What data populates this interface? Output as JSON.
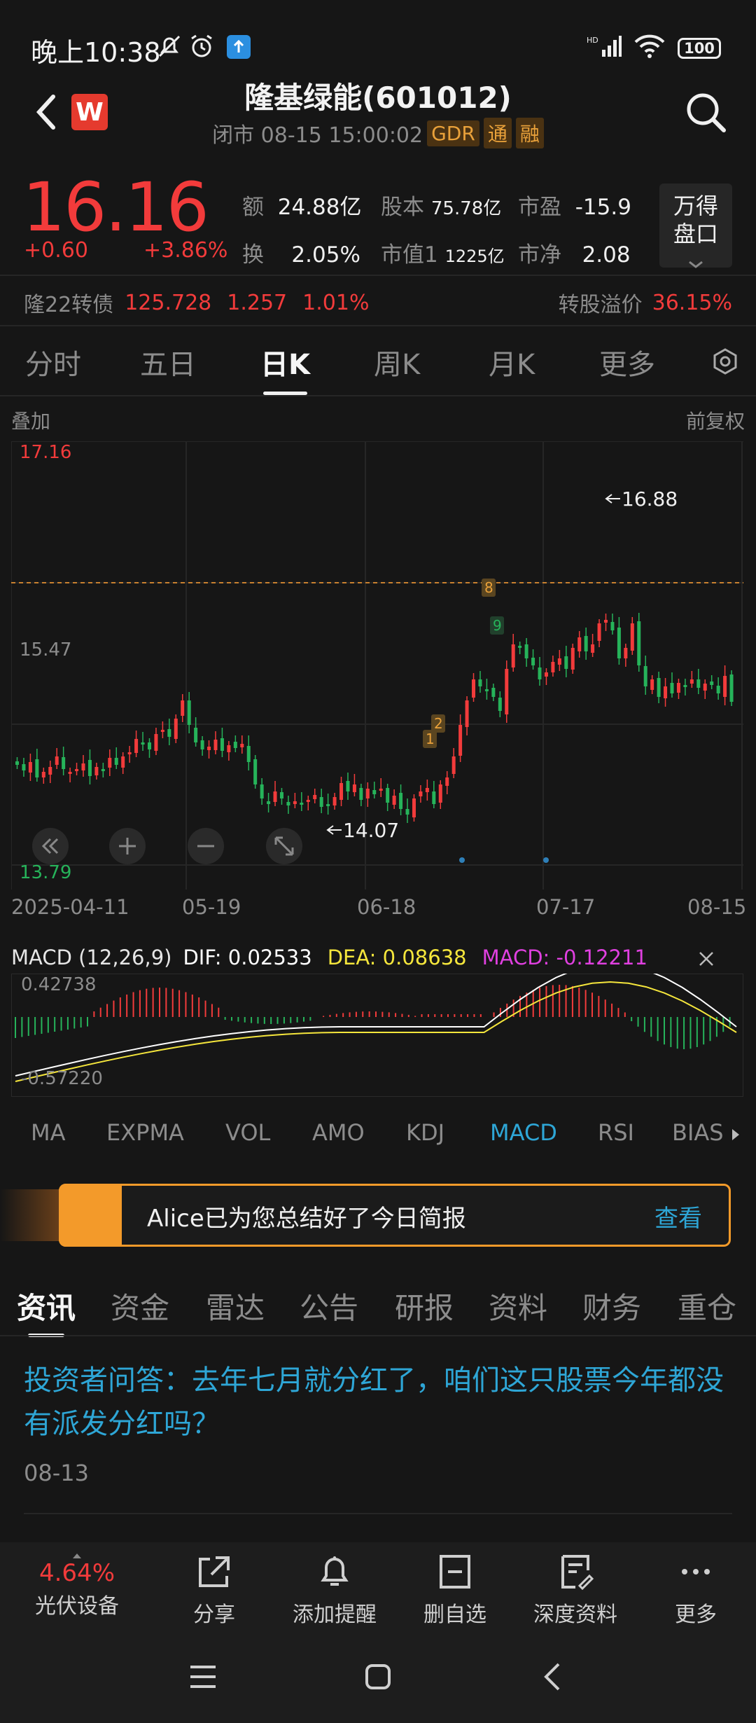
{
  "status": {
    "time": "晚上10:38",
    "battery": "100",
    "signal": "HD"
  },
  "header": {
    "title": "隆基绿能(601012)",
    "subtitle": "闭市 08-15 15:00:02",
    "tags": [
      "GDR",
      "通",
      "融"
    ],
    "logo": "W"
  },
  "quote": {
    "price": "16.16",
    "change": "+0.60",
    "change_pct": "+3.86%",
    "stats": [
      {
        "k": "额",
        "v": "24.88亿"
      },
      {
        "k": "股本",
        "v": "75.78亿"
      },
      {
        "k": "市盈",
        "v": "-15.9"
      },
      {
        "k": "换",
        "v": "2.05%"
      },
      {
        "k": "市值1",
        "v": "1225亿"
      },
      {
        "k": "市净",
        "v": "2.08"
      }
    ],
    "wande_line1": "万得",
    "wande_line2": "盘口"
  },
  "bond": {
    "name": "隆22转债",
    "price": "125.728",
    "change": "1.257",
    "pct": "1.01%",
    "premium_label": "转股溢价",
    "premium": "36.15%"
  },
  "chart_tabs": [
    "分时",
    "五日",
    "日K",
    "周K",
    "月K",
    "更多"
  ],
  "overlay_label": "叠加",
  "fq_label": "前复权",
  "kline": {
    "price_top": "17.16",
    "price_mid": "15.47",
    "price_bottom": "13.79",
    "high_label": "16.88",
    "low_label": "14.07",
    "markers": [
      "1",
      "2",
      "8",
      "9"
    ],
    "dates": [
      "2025-04-11",
      "05-19",
      "06-18",
      "07-17",
      "08-15"
    ]
  },
  "macd": {
    "params": "MACD (12,26,9)",
    "dif": "DIF: 0.02533",
    "dea": "DEA: 0.08638",
    "macd": "MACD: -0.12211",
    "top": "0.42738",
    "bottom": "-0.57220",
    "colors": {
      "dif": "#ffffff",
      "dea": "#f5e63c",
      "macd": "#e040e0"
    }
  },
  "indicator_tabs": [
    "MA",
    "EXPMA",
    "VOL",
    "AMO",
    "KDJ",
    "MACD",
    "RSI",
    "BIAS"
  ],
  "banner": {
    "text": "Alice已为您总结好了今日简报",
    "action": "查看"
  },
  "news_tabs": [
    "资讯",
    "资金",
    "雷达",
    "公告",
    "研报",
    "资料",
    "财务",
    "重仓"
  ],
  "news": {
    "title": "投资者问答：去年七月就分红了，咱们这只股票今年都没有派发分红吗？",
    "date": "08-13"
  },
  "bottom": {
    "sector_pct": "4.64%",
    "sector_name": "光伏设备",
    "share": "分享",
    "alert": "添加提醒",
    "remove": "删自选",
    "deep": "深度资料",
    "more": "更多"
  },
  "colors": {
    "up": "#f23b3b",
    "down": "#26b35a",
    "accent": "#2ea6d6",
    "orange": "#f39a2a"
  }
}
